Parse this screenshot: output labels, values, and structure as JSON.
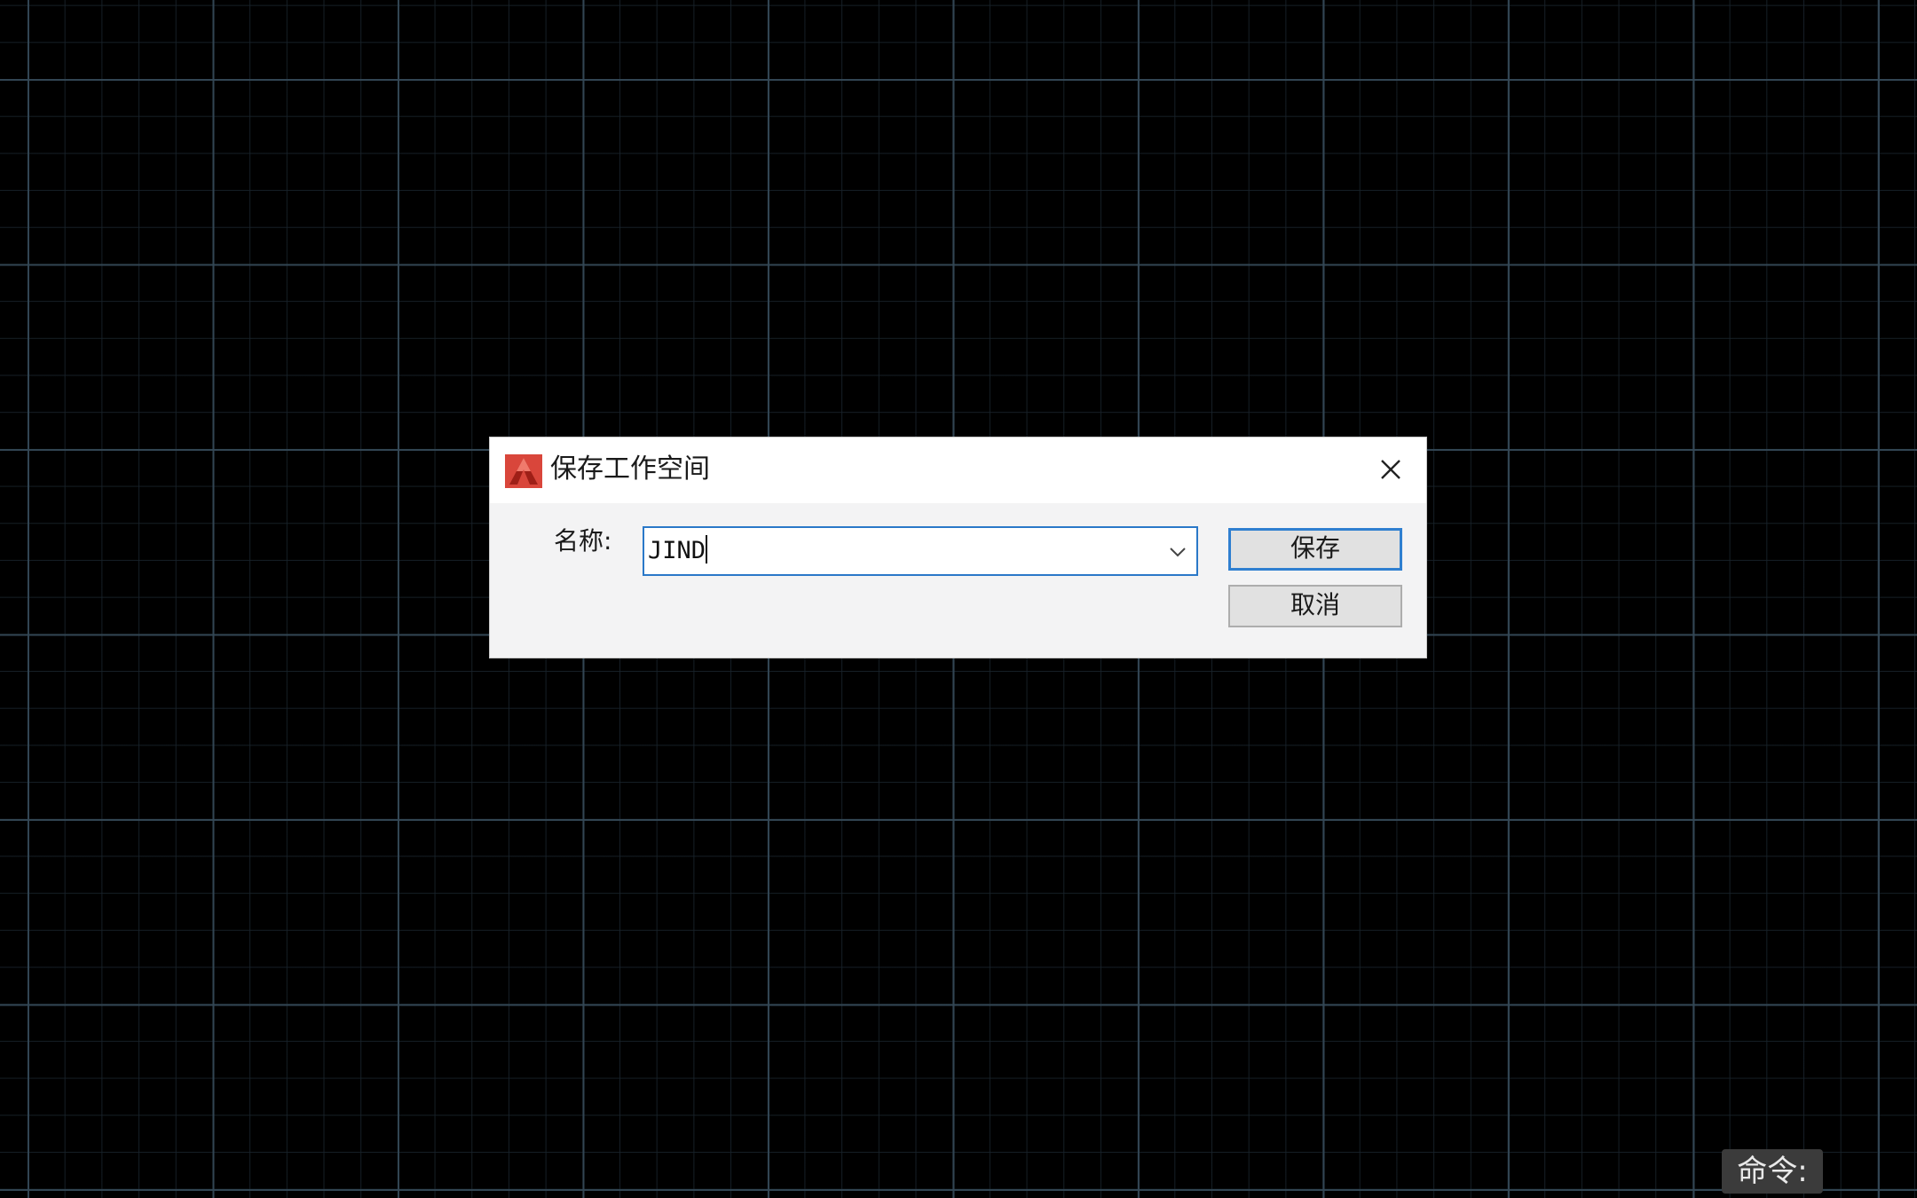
{
  "dialog": {
    "title": "保存工作空间",
    "app_icon": "autocad-logo-icon",
    "close_icon": "close-icon",
    "name_label": "名称:",
    "name_value": "JIND",
    "dropdown_icon": "chevron-down-icon",
    "save_label": "保存",
    "cancel_label": "取消"
  },
  "command_line": {
    "prompt": "命令:"
  },
  "colors": {
    "canvas_background": "#000000",
    "grid_major": "#344856",
    "grid_minor": "#18222a",
    "focus_blue": "#2a78c8",
    "logo_red": "#c8372d"
  }
}
